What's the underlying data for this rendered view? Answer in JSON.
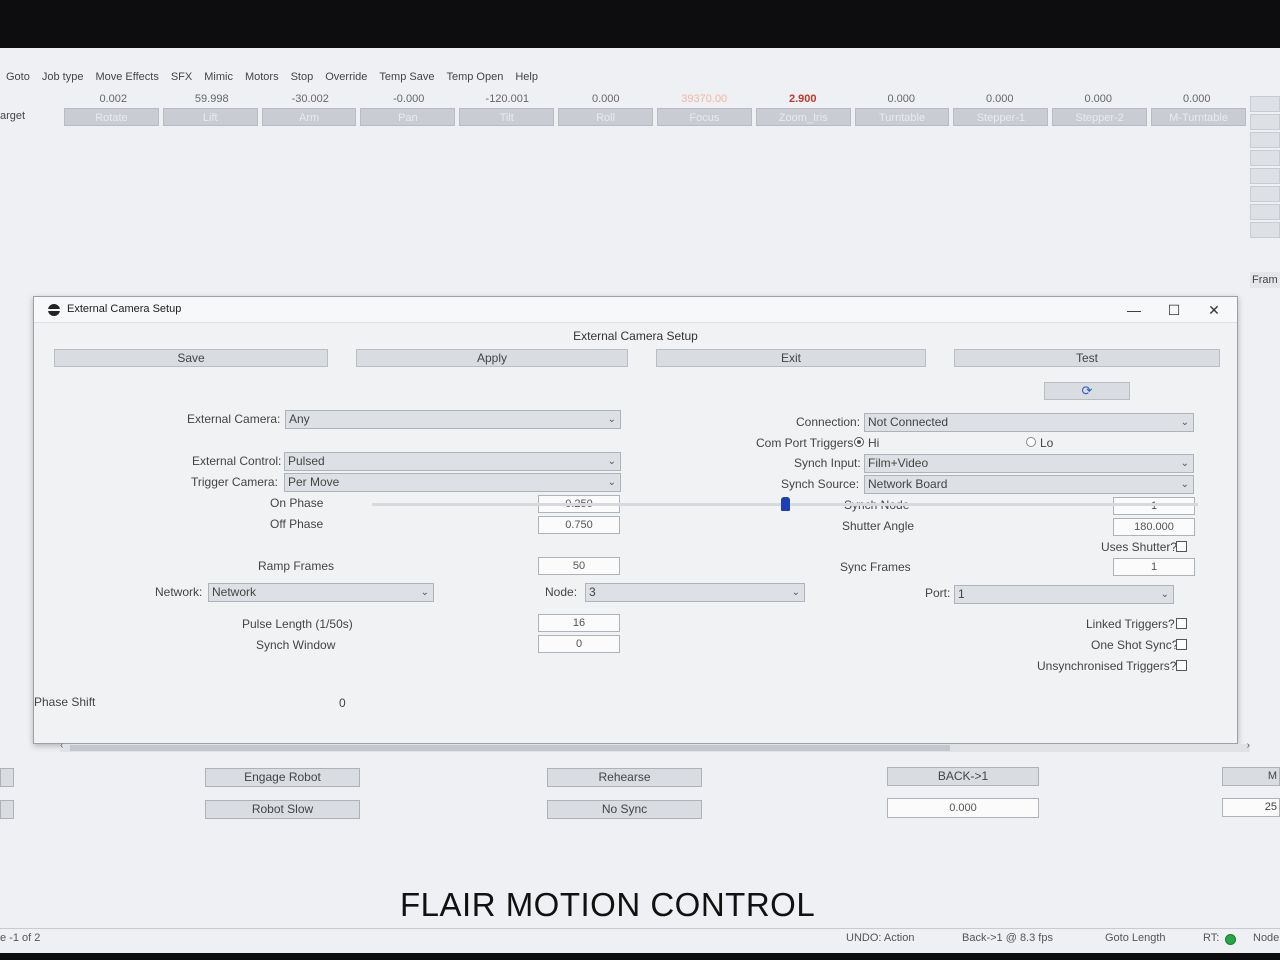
{
  "menu": [
    "Goto",
    "Job type",
    "Move Effects",
    "SFX",
    "Mimic",
    "Motors",
    "Stop",
    "Override",
    "Temp Save",
    "Temp Open",
    "Help"
  ],
  "target_label": "arget",
  "axes": [
    {
      "name": "Rotate",
      "value": "0.002"
    },
    {
      "name": "Lift",
      "value": "59.998"
    },
    {
      "name": "Arm",
      "value": "-30.002"
    },
    {
      "name": "Pan",
      "value": "-0.000"
    },
    {
      "name": "Tilt",
      "value": "-120.001"
    },
    {
      "name": "Roll",
      "value": "0.000"
    },
    {
      "name": "Focus",
      "value": "39370.00"
    },
    {
      "name": "Zoom_Iris",
      "value": "2.900"
    },
    {
      "name": "Turntable",
      "value": "0.000"
    },
    {
      "name": "Stepper-1",
      "value": "0.000"
    },
    {
      "name": "Stepper-2",
      "value": "0.000"
    },
    {
      "name": "M-Turntable",
      "value": "0.000"
    }
  ],
  "right_strip_label": "Fram",
  "dialog": {
    "window_title": "External Camera Setup",
    "heading": "External Camera Setup",
    "controls": {
      "minimize": "—",
      "maximize": "☐",
      "close": "✕"
    },
    "buttons": {
      "save": "Save",
      "apply": "Apply",
      "exit": "Exit",
      "test": "Test",
      "refresh_glyph": "⟳"
    },
    "external_camera": {
      "label": "External Camera:",
      "value": "Any"
    },
    "external_control": {
      "label": "External Control:",
      "value": "Pulsed"
    },
    "trigger_camera": {
      "label": "Trigger Camera:",
      "value": "Per Move"
    },
    "on_phase": {
      "label": "On Phase",
      "value": "0.250"
    },
    "off_phase": {
      "label": "Off Phase",
      "value": "0.750"
    },
    "ramp_frames": {
      "label": "Ramp Frames",
      "value": "50"
    },
    "network": {
      "label": "Network:",
      "value": "Network"
    },
    "node": {
      "label": "Node:",
      "value": "3"
    },
    "port": {
      "label": "Port:",
      "value": "1"
    },
    "pulse_length": {
      "label": "Pulse Length (1/50s)",
      "value": "16"
    },
    "synch_window": {
      "label": "Synch Window",
      "value": "0"
    },
    "connection": {
      "label": "Connection:",
      "value": "Not Connected"
    },
    "com_port_triggers": {
      "label": "Com Port Triggers",
      "hi": "Hi",
      "lo": "Lo",
      "selected": "Hi"
    },
    "synch_input": {
      "label": "Synch Input:",
      "value": "Film+Video"
    },
    "synch_source": {
      "label": "Synch Source:",
      "value": "Network Board"
    },
    "synch_node": {
      "label": "Synch Node",
      "value": "1"
    },
    "shutter_angle": {
      "label": "Shutter Angle",
      "value": "180.000"
    },
    "uses_shutter": {
      "label": "Uses Shutter?"
    },
    "sync_frames": {
      "label": "Sync Frames",
      "value": "1"
    },
    "linked_triggers": {
      "label": "Linked Triggers?"
    },
    "one_shot_sync": {
      "label": "One Shot Sync?"
    },
    "unsynchronised_triggers": {
      "label": "Unsynchronised Triggers?"
    },
    "phase_shift": {
      "label": "Phase Shift",
      "value": "0",
      "slider_fraction": 0.5
    }
  },
  "bottom": {
    "engage_robot": "Engage Robot",
    "robot_slow": "Robot Slow",
    "rehearse": "Rehearse",
    "no_sync": "No Sync",
    "back_to_1": "BACK->1",
    "back_value": "0.000",
    "right_stub_1": "M",
    "right_stub_2": "25"
  },
  "brand": "FLAIR MOTION CONTROL",
  "status": {
    "page": "e -1 of 2",
    "undo": "UNDO: Action",
    "back_fps": "Back->1 @ 8.3 fps",
    "goto_length": "Goto Length",
    "rt": "RT:",
    "node": "Node"
  },
  "colors": {
    "red_value": "#c0392b",
    "rt_indicator": "#27a844",
    "slider_thumb": "#1c3fb8"
  }
}
